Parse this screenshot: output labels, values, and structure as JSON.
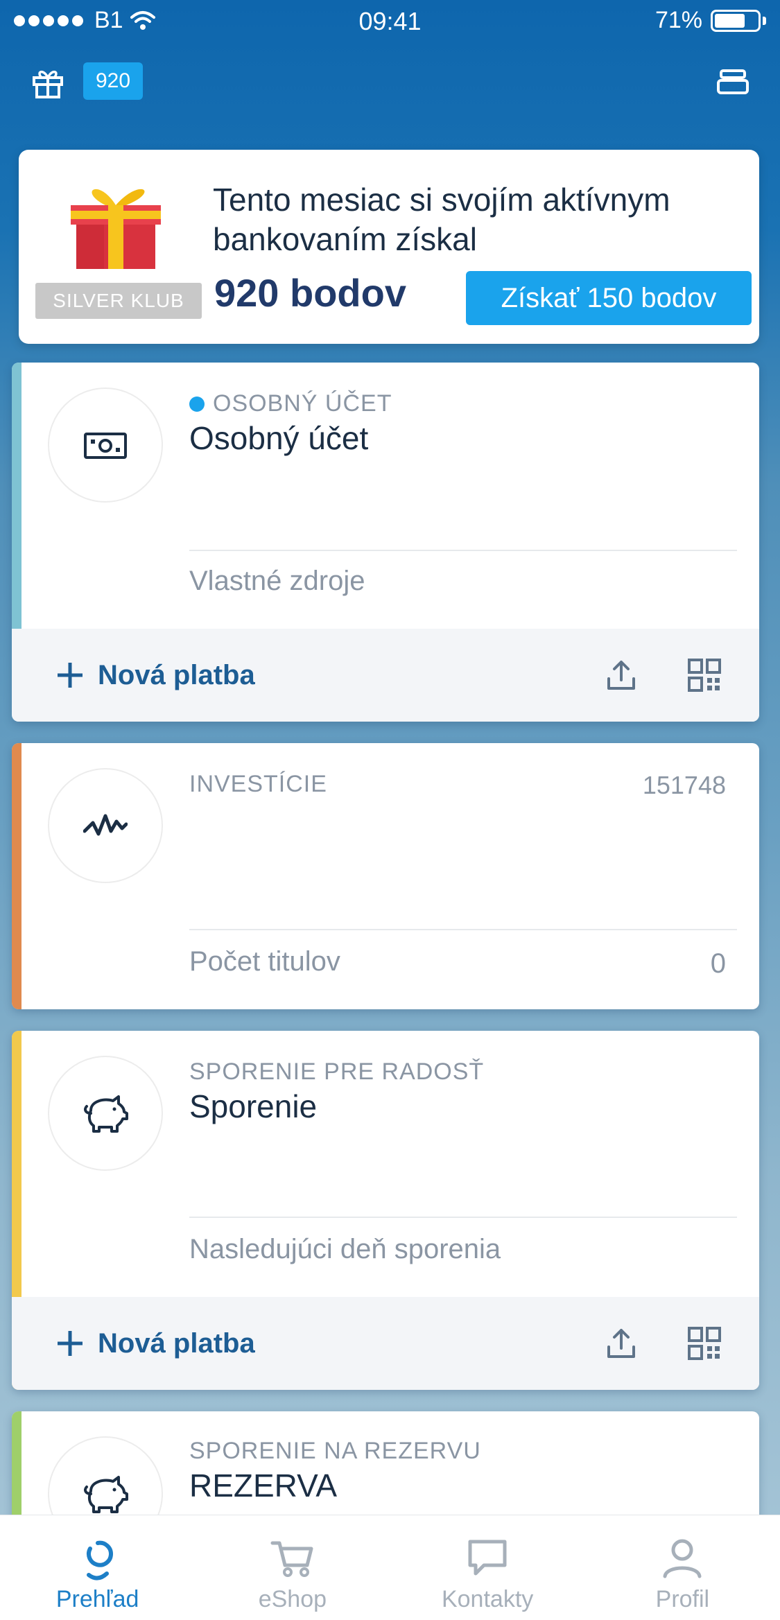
{
  "status_bar": {
    "carrier": "B1",
    "time": "09:41",
    "battery": "71%",
    "battery_level": 0.71
  },
  "header": {
    "points_badge": "920"
  },
  "promo": {
    "club_label": "SILVER KLUB",
    "message": "Tento mesiac si svojím aktívnym bankovaním získal",
    "points": "920 bodov",
    "cta_label": "Získať 150 bodov"
  },
  "accounts": [
    {
      "category": "OSOBNÝ ÚČET",
      "name": "Osobný účet",
      "sub_label": "Vlastné zdroje",
      "new_payment_label": "Nová platba",
      "accent_color": "#7fc3d3",
      "icon": "banknote-icon"
    },
    {
      "category": "INVESTÍCIE",
      "value": "151748",
      "sub_label": "Počet titulov",
      "sub_value": "0",
      "accent_color": "#e08a4e",
      "icon": "pulse-chart-icon"
    },
    {
      "category": "SPORENIE PRE RADOSŤ",
      "name": "Sporenie",
      "sub_label": "Nasledujúci deň sporenia",
      "new_payment_label": "Nová platba",
      "accent_color": "#f2c94c",
      "icon": "piggy-bank-icon"
    },
    {
      "category": "SPORENIE NA REZERVU",
      "name": "REZERVA",
      "accent_color": "#9fcf6a",
      "icon": "piggy-bank-icon"
    }
  ],
  "tabs": [
    {
      "label": "Prehľad",
      "icon": "overview-icon",
      "active": true
    },
    {
      "label": "eShop",
      "icon": "cart-icon",
      "active": false
    },
    {
      "label": "Kontakty",
      "icon": "chat-bubble-icon",
      "active": false
    },
    {
      "label": "Profil",
      "icon": "person-icon",
      "active": false
    }
  ],
  "colors": {
    "brand_blue": "#0e66ad",
    "accent_blue": "#1aa3ec",
    "link_blue": "#1d5d94"
  }
}
